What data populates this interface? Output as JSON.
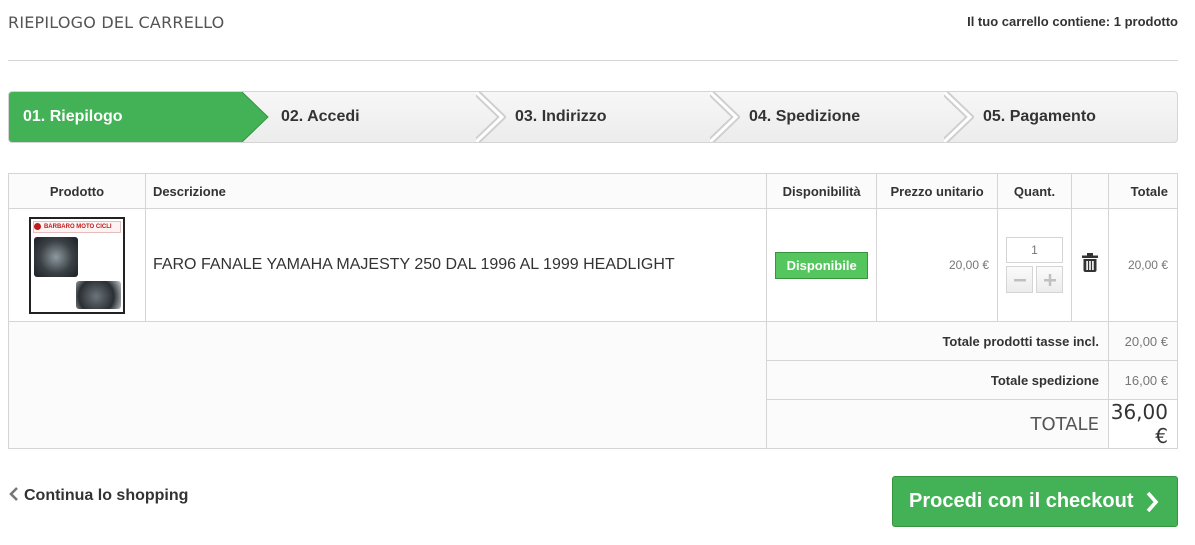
{
  "header": {
    "title": "RIEPILOGO DEL CARRELLO",
    "cart_summary": "Il tuo carrello contiene: 1 prodotto"
  },
  "steps": [
    {
      "label": "01. Riepilogo",
      "active": true
    },
    {
      "label": "02. Accedi",
      "active": false
    },
    {
      "label": "03. Indirizzo",
      "active": false
    },
    {
      "label": "04. Spedizione",
      "active": false
    },
    {
      "label": "05. Pagamento",
      "active": false
    }
  ],
  "table": {
    "columns": [
      "Prodotto",
      "Descrizione",
      "Disponibilità",
      "Prezzo unitario",
      "Quant.",
      "",
      "Totale"
    ],
    "rows": [
      {
        "image_brand": "BARBARO MOTO CICLI",
        "description": "FARO FANALE YAMAHA MAJESTY 250 DAL 1996 AL 1999 HEADLIGHT",
        "availability": "Disponibile",
        "unit_price": "20,00 €",
        "quantity": "1",
        "total": "20,00 €"
      }
    ],
    "totals": {
      "products_label": "Totale prodotti tasse incl.",
      "products_value": "20,00 €",
      "shipping_label": "Totale spedizione",
      "shipping_value": "16,00 €",
      "grand_label": "TOTALE",
      "grand_value": "36,00 €"
    }
  },
  "actions": {
    "continue_label": "Continua lo shopping",
    "checkout_label": "Procedi con il checkout"
  },
  "icons": {
    "delete": "trash-icon",
    "back": "chevron-left-icon",
    "forward": "chevron-right-icon",
    "minus": "minus-icon",
    "plus": "plus-icon"
  },
  "colors": {
    "accent_green": "#43b155",
    "badge_green": "#55c65e",
    "border": "#d6d4d4"
  }
}
